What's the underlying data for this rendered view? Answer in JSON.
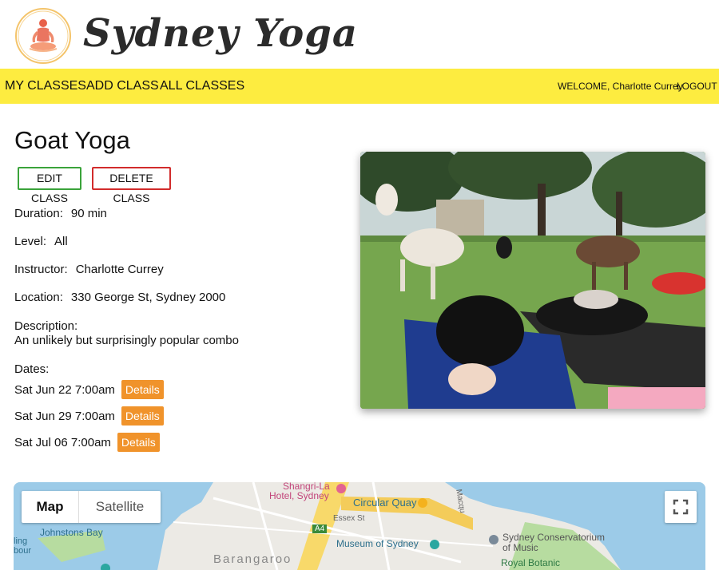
{
  "header": {
    "brand": "Sydney Yoga"
  },
  "nav": {
    "my_classes": "MY CLASSES",
    "add_class": "ADD CLASS",
    "all_classes": "ALL CLASSES",
    "welcome": "WELCOME, Charlotte Currey",
    "logout": "LOGOUT"
  },
  "class": {
    "title": "Goat Yoga",
    "edit_label": "EDIT CLASS",
    "delete_label": "DELETE CLASS",
    "duration_label": "Duration:",
    "duration": "90 min",
    "level_label": "Level:",
    "level": "All",
    "instructor_label": "Instructor:",
    "instructor": "Charlotte Currey",
    "location_label": "Location:",
    "location": "330 George St, Sydney 2000",
    "description_label": "Description:",
    "description": "An unlikely but surprisingly popular combo",
    "dates_label": "Dates:",
    "details_label": "Details",
    "dates": [
      "Sat Jun 22 7:00am",
      "Sat Jun 29 7:00am",
      "Sat Jul 06 7:00am"
    ]
  },
  "map": {
    "map_label": "Map",
    "satellite_label": "Satellite",
    "places": {
      "shangri": "Shangri-La",
      "hotel": "Hotel, Sydney",
      "circular_quay": "Circular Quay",
      "essex": "Essex St",
      "johnstons_bay": "Johnstons Bay",
      "museum": "Museum of Sydney",
      "conservatorium": "Sydney Conservatorium",
      "of_music": "of Music",
      "barangaroo": "Barangaroo",
      "royal_botanic": "Royal Botanic",
      "a4": "A4",
      "ling": "ling",
      "bour": "bour",
      "macqu": "Macqu"
    }
  },
  "colors": {
    "nav_bg": "#fdec40",
    "details_bg": "#f0932b",
    "edit_border": "#3aa33a",
    "delete_border": "#d22c2c"
  }
}
